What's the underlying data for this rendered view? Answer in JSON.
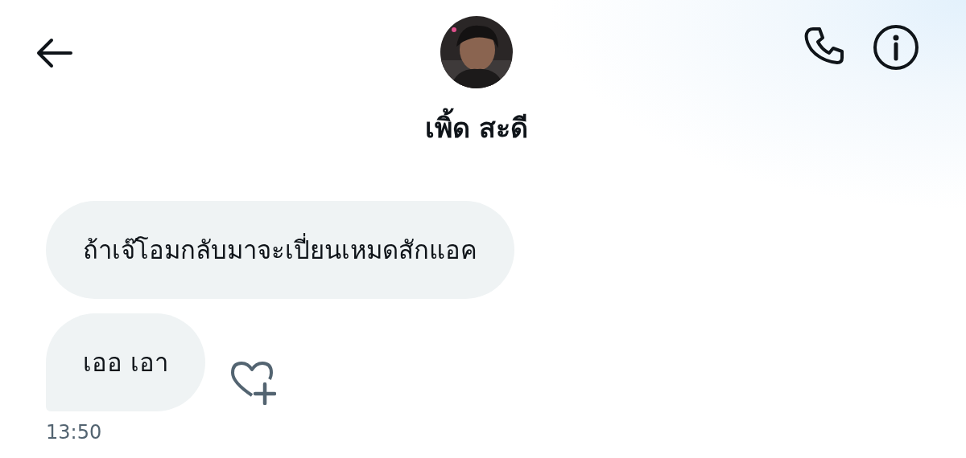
{
  "header": {
    "name": "เพิ้ด สะดี"
  },
  "messages": [
    {
      "text": "ถ้าเจ๊โอมกลับมาจะเปี่ยนเหมดสักแอค",
      "reaction_button": false,
      "last_in_group": false
    },
    {
      "text": "เออ เอา",
      "reaction_button": true,
      "last_in_group": true
    }
  ],
  "timestamp": "13:50"
}
